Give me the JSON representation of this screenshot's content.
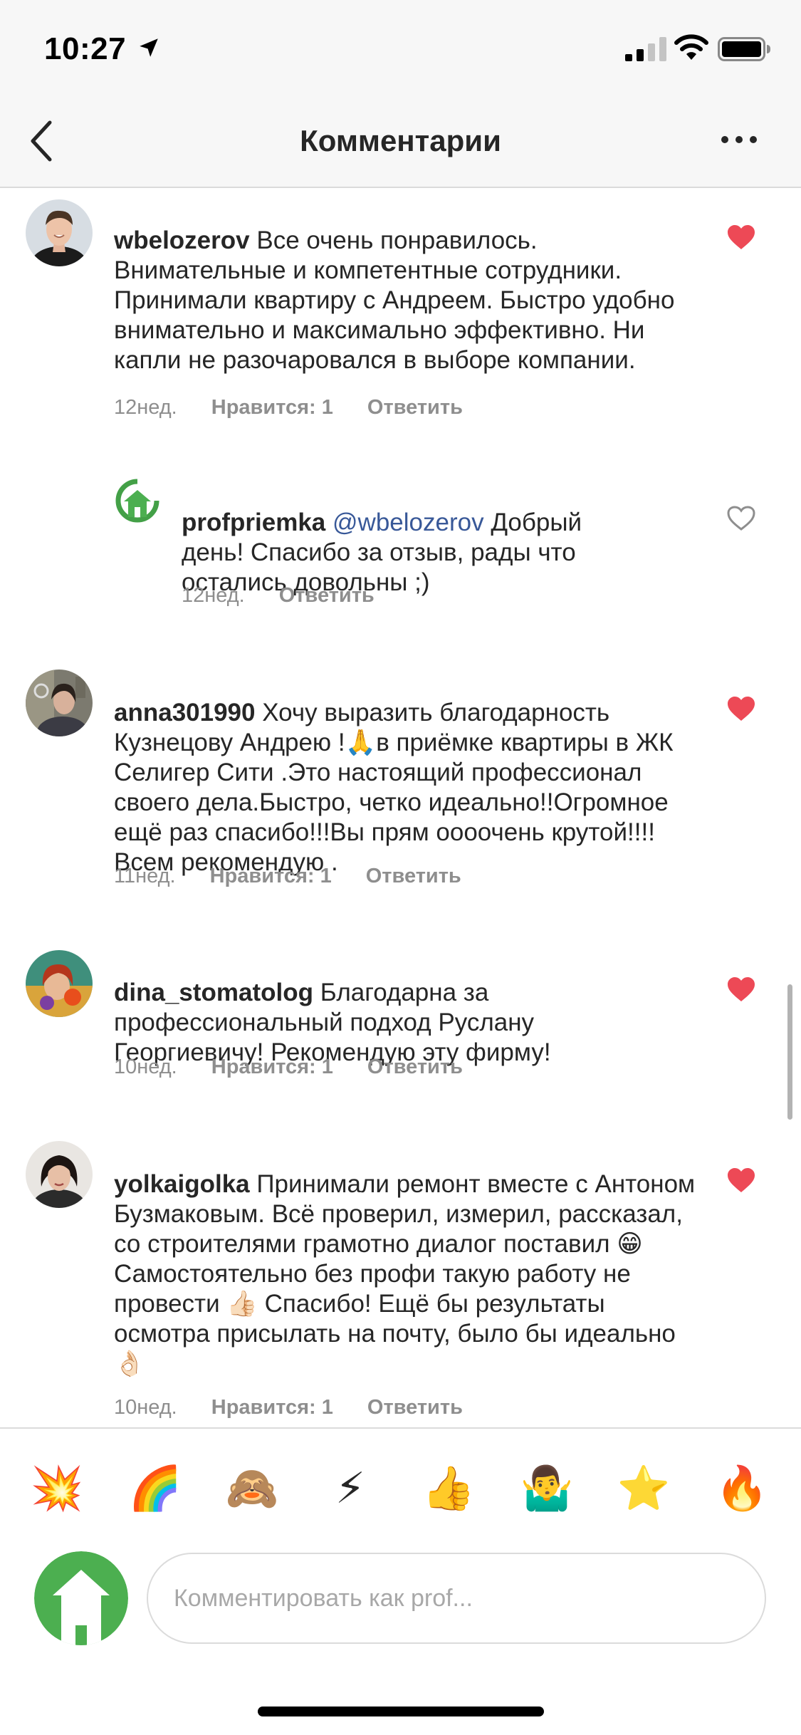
{
  "status_bar": {
    "time": "10:27",
    "icons": [
      "location-arrow-icon",
      "cellular-signal-icon",
      "wifi-icon",
      "battery-icon"
    ]
  },
  "header": {
    "title": "Комментарии",
    "back_icon": "chevron-left-icon",
    "more_icon": "more-horizontal-icon"
  },
  "comments": [
    {
      "username": "wbelozerov",
      "text": "Все очень понравилось. Внимательные и компетентные сотрудники. Принимали квартиру с Андреем. Быстро удобно внимательно и максимально эффективно. Ни капли не разочаровался в выборе компании.",
      "time": "12нед.",
      "likes": "Нравится: 1",
      "reply": "Ответить",
      "liked": true
    },
    {
      "username": "profpriemka",
      "mention": "@wbelozerov",
      "text": "Добрый день! Спасибо за отзыв, рады что остались довольны ;)",
      "time": "12нед.",
      "reply": "Ответить",
      "liked": false
    },
    {
      "username": "anna301990",
      "text": "Хочу выразить благодарность Кузнецову Андрею !🙏в приёмке квартиры в ЖК Селигер Сити .Это настоящий профессионал своего дела.Быстро, четко идеально!!Огромное ещё раз спасибо!!!Вы прям оооочень крутой!!!!Всем рекомендую .",
      "time": "11нед.",
      "likes": "Нравится: 1",
      "reply": "Ответить",
      "liked": true
    },
    {
      "username": "dina_stomatolog",
      "text": "Благодарна за профессиональный подход Руслану Георгиевичу! Рекомендую эту фирму!",
      "time": "10нед.",
      "likes": "Нравится: 1",
      "reply": "Ответить",
      "liked": true
    },
    {
      "username": "yolkaigolka",
      "text": "Принимали ремонт вместе с Антоном Бузмаковым. Всё проверил, измерил, рассказал, со строителями грамотно диалог поставил 😁 Самостоятельно без профи такую работу не провести 👍🏻 Спасибо! Ещё бы результаты осмотра присылать на почту, было бы идеально 👌🏻",
      "time": "10нед.",
      "likes": "Нравится: 1",
      "reply": "Ответить",
      "liked": true
    }
  ],
  "emoji_bar": [
    "💥",
    "🌈",
    "🙈",
    "⚡",
    "👍",
    "🤷‍♂️",
    "⭐",
    "🔥"
  ],
  "composer": {
    "placeholder": "Комментировать как prof..."
  },
  "colors": {
    "heart_red": "#ed4956",
    "brand_green": "#4caf50",
    "mention_blue": "#385898",
    "meta_gray": "#8e8e8e"
  }
}
